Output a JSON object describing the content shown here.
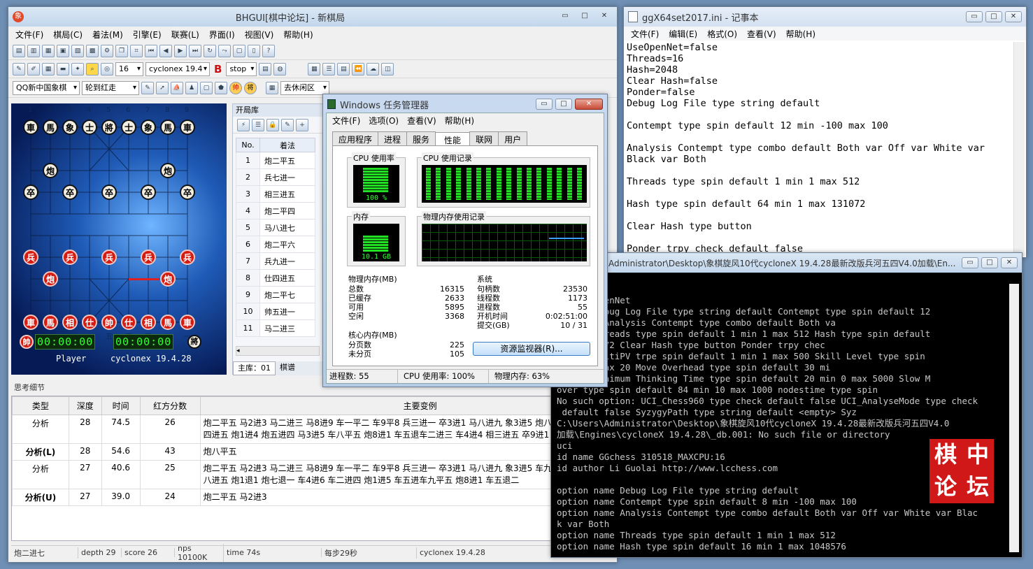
{
  "bhgui": {
    "title": "BHGUI[棋中论坛] - 新棋局",
    "menu": [
      "文件(F)",
      "棋局(C)",
      "着法(M)",
      "引擎(E)",
      "联赛(L)",
      "界面(I)",
      "视图(V)",
      "帮助(H)"
    ],
    "depth_value": "16",
    "engine_select": "cyclonex 19.4",
    "stop_select": "stop",
    "board_select": "QQ新中国象棋",
    "turn_select": "轮到红走",
    "mode_select": "去休闲区",
    "add_select": "加入",
    "opening_panel_title": "开局库",
    "opening_headers": [
      "No.",
      "着法"
    ],
    "opening_rows": [
      [
        "1",
        "炮二平五"
      ],
      [
        "2",
        "兵七进一"
      ],
      [
        "3",
        "相三进五"
      ],
      [
        "4",
        "炮二平四"
      ],
      [
        "5",
        "马八进七"
      ],
      [
        "6",
        "炮二平六"
      ],
      [
        "7",
        "兵九进一"
      ],
      [
        "8",
        "仕四进五"
      ],
      [
        "9",
        "炮二平七"
      ],
      [
        "10",
        "帅五进一"
      ],
      [
        "11",
        "马二进三"
      ]
    ],
    "opening_tab_main": "主库：01",
    "opening_tab_variation": "棋谱",
    "clock_red": "00:00:00",
    "clock_black": "00:00:00",
    "red_general": "帥",
    "black_general": "將",
    "player_name": "Player",
    "engine_name": "cyclonex 19.4.28",
    "file_labels_top": [
      "1",
      "2",
      "3",
      "4",
      "5",
      "6",
      "7",
      "8",
      "9"
    ],
    "file_labels_bottom": [
      "九",
      "八",
      "七",
      "六",
      "五",
      "四",
      "三",
      "二",
      "一"
    ],
    "thinking_title": "思考细节",
    "thinking_headers": [
      "类型",
      "深度",
      "时间",
      "红方分数",
      "主要变例"
    ],
    "thinking_rows": [
      {
        "type": "分析",
        "depth": "28",
        "time": "74.5",
        "score": "26",
        "pv": "炮二平五 马2进3 马二进三 马8进9 车一平二 车9平8 兵三进一 卒3进1 马八进九 象3进5 炮八平车九平八 炮2平1 车八进六 车1平4 仕四进五 炮1进4 炮五进四 马3进5 车八平五 炮8进1 车五退车二进三 车4进4 相三进五 卒9进1 车五平八"
      },
      {
        "type": "分析(L)",
        "depth": "28",
        "time": "54.6",
        "score": "43",
        "pv": "炮八平五"
      },
      {
        "type": "分析",
        "depth": "27",
        "time": "40.6",
        "score": "25",
        "pv": "炮二平五 马2进3 马二进三 马8进9 车一平二 车9平8 兵三进一 卒3进1 马八进九 象3进5 车九进炮八平七 士4进5 车九平八 车1平4 车八进五 炮1退1 炮七退一 车4进6 车二进四 炮1进5 车五进车九平五 炮8进1 车五退二"
      },
      {
        "type": "分析(U)",
        "depth": "27",
        "time": "39.0",
        "score": "24",
        "pv": "炮二平五 马2进3"
      }
    ],
    "status": [
      "炮二进七",
      "depth 29",
      "score 26",
      "nps 10100K",
      "time 74s",
      "每步29秒",
      "cyclonex 19.4.28"
    ]
  },
  "notepad": {
    "title": "ggX64set2017.ini - 记事本",
    "menu": [
      "文件(F)",
      "编辑(E)",
      "格式(O)",
      "查看(V)",
      "帮助(H)"
    ],
    "lines": [
      "UseOpenNet=false",
      "Threads=16",
      "Hash=2048",
      "Clear Hash=false",
      "Ponder=false",
      "Debug Log File type string default",
      "",
      "Contempt type spin default 12 min -100 max 100",
      "",
      "Analysis Contempt type combo default Both var Off var White var",
      "Black var Both",
      "",
      "Threads type spin default 1 min 1 max 512",
      "",
      "Hash type spin default 64 min 1 max 131072",
      "",
      "Clear Hash type button",
      "",
      "Ponder trpy check default false"
    ]
  },
  "console": {
    "title": "Administrator\\Desktop\\象棋旋风10代cycloneX 19.4.28最新改版兵河五四V4.0加载\\En...",
    "lines": [
      "end",
      "on: UseOpenNet",
      "ption: Debug Log File type string default Contempt type spin default 12",
      " max 100 Analysis Contempt type combo default Both va",
      "ption: Threads type spin default 1 min 1 max 512 Hash type spin default",
      " max 131072 Clear Hash type button Ponder trpy chec",
      "ption: MultiPV trpe spin default 1 min 1 max 500 Skill Level type spin",
      "0 min 0 max 20 Move Overhead type spin default 30 mi",
      "ption: Minimum Thinking Time type spin default 20 min 0 max 5000 Slow M",
      "over type spin default 84 min 10 max 1000 nodestime type spin",
      "No such option: UCI_Chess960 type check default false UCI_AnalyseMode type check",
      " default false SyzygyPath type string default <empty> Syz",
      "C:\\Users\\Administrator\\Desktop\\象棋旋风10代cycloneX 19.4.28最新改版兵河五四V4.0",
      "加载\\Engines\\cycloneX 19.4.28\\_db.001: No such file or directory",
      "uci",
      "id name GGchess 310518_MAXCPU:16",
      "id author Li Guolai http://www.lcchess.com",
      "",
      "option name Debug Log File type string default",
      "option name Contempt type spin default 8 min -100 max 100",
      "option name Analysis Contempt type combo default Both var Off var White var Blac",
      "k var Both",
      "option name Threads type spin default 1 min 1 max 512",
      "option name Hash type spin default 16 min 1 max 1048576"
    ],
    "stamp": [
      "棋",
      "中",
      "论",
      "坛"
    ]
  },
  "taskmgr": {
    "title": "Windows 任务管理器",
    "menu": [
      "文件(F)",
      "选项(O)",
      "查看(V)",
      "帮助(H)"
    ],
    "tabs": [
      "应用程序",
      "进程",
      "服务",
      "性能",
      "联网",
      "用户"
    ],
    "cpu_usage_label": "CPU 使用率",
    "cpu_usage_value": "100 %",
    "cpu_history_label": "CPU 使用记录",
    "mem_label": "内存",
    "mem_value": "10.1 GB",
    "mem_history_label": "物理内存使用记录",
    "physmem_title": "物理内存(MB)",
    "physmem": [
      [
        "总数",
        "16315"
      ],
      [
        "已缓存",
        "2633"
      ],
      [
        "可用",
        "5895"
      ],
      [
        "空闲",
        "3368"
      ]
    ],
    "kernel_title": "核心内存(MB)",
    "kernel": [
      [
        "分页数",
        "225"
      ],
      [
        "未分页",
        "105"
      ]
    ],
    "system_title": "系统",
    "system": [
      [
        "句柄数",
        "23530"
      ],
      [
        "线程数",
        "1173"
      ],
      [
        "进程数",
        "55"
      ],
      [
        "开机时间",
        "0:02:51:00"
      ],
      [
        "提交(GB)",
        "10 / 31"
      ]
    ],
    "resmon_button": "资源监视器(R)...",
    "status": [
      "进程数: 55",
      "CPU 使用率: 100%",
      "物理内存: 63%"
    ],
    "cpu_usage_fraction": 1.0,
    "mem_usage_fraction": 0.63
  }
}
